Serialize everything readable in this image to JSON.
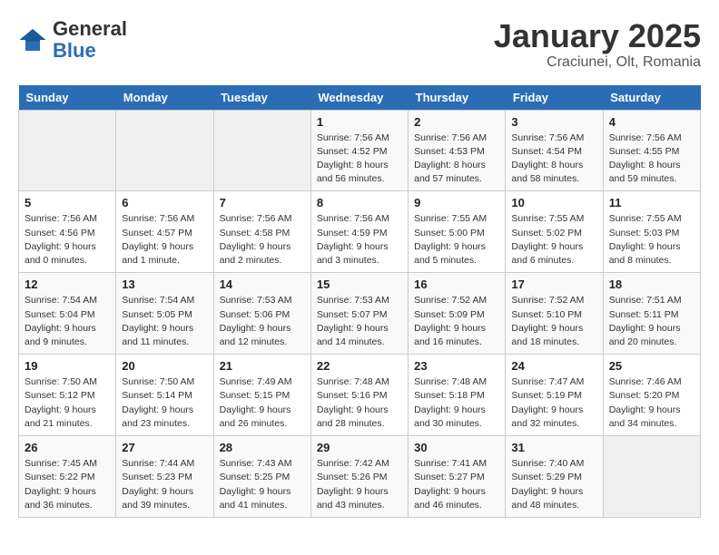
{
  "logo": {
    "general": "General",
    "blue": "Blue"
  },
  "header": {
    "title": "January 2025",
    "subtitle": "Craciunei, Olt, Romania"
  },
  "days_of_week": [
    "Sunday",
    "Monday",
    "Tuesday",
    "Wednesday",
    "Thursday",
    "Friday",
    "Saturday"
  ],
  "weeks": [
    [
      {
        "day": "",
        "info": ""
      },
      {
        "day": "",
        "info": ""
      },
      {
        "day": "",
        "info": ""
      },
      {
        "day": "1",
        "info": "Sunrise: 7:56 AM\nSunset: 4:52 PM\nDaylight: 8 hours\nand 56 minutes."
      },
      {
        "day": "2",
        "info": "Sunrise: 7:56 AM\nSunset: 4:53 PM\nDaylight: 8 hours\nand 57 minutes."
      },
      {
        "day": "3",
        "info": "Sunrise: 7:56 AM\nSunset: 4:54 PM\nDaylight: 8 hours\nand 58 minutes."
      },
      {
        "day": "4",
        "info": "Sunrise: 7:56 AM\nSunset: 4:55 PM\nDaylight: 8 hours\nand 59 minutes."
      }
    ],
    [
      {
        "day": "5",
        "info": "Sunrise: 7:56 AM\nSunset: 4:56 PM\nDaylight: 9 hours\nand 0 minutes."
      },
      {
        "day": "6",
        "info": "Sunrise: 7:56 AM\nSunset: 4:57 PM\nDaylight: 9 hours\nand 1 minute."
      },
      {
        "day": "7",
        "info": "Sunrise: 7:56 AM\nSunset: 4:58 PM\nDaylight: 9 hours\nand 2 minutes."
      },
      {
        "day": "8",
        "info": "Sunrise: 7:56 AM\nSunset: 4:59 PM\nDaylight: 9 hours\nand 3 minutes."
      },
      {
        "day": "9",
        "info": "Sunrise: 7:55 AM\nSunset: 5:00 PM\nDaylight: 9 hours\nand 5 minutes."
      },
      {
        "day": "10",
        "info": "Sunrise: 7:55 AM\nSunset: 5:02 PM\nDaylight: 9 hours\nand 6 minutes."
      },
      {
        "day": "11",
        "info": "Sunrise: 7:55 AM\nSunset: 5:03 PM\nDaylight: 9 hours\nand 8 minutes."
      }
    ],
    [
      {
        "day": "12",
        "info": "Sunrise: 7:54 AM\nSunset: 5:04 PM\nDaylight: 9 hours\nand 9 minutes."
      },
      {
        "day": "13",
        "info": "Sunrise: 7:54 AM\nSunset: 5:05 PM\nDaylight: 9 hours\nand 11 minutes."
      },
      {
        "day": "14",
        "info": "Sunrise: 7:53 AM\nSunset: 5:06 PM\nDaylight: 9 hours\nand 12 minutes."
      },
      {
        "day": "15",
        "info": "Sunrise: 7:53 AM\nSunset: 5:07 PM\nDaylight: 9 hours\nand 14 minutes."
      },
      {
        "day": "16",
        "info": "Sunrise: 7:52 AM\nSunset: 5:09 PM\nDaylight: 9 hours\nand 16 minutes."
      },
      {
        "day": "17",
        "info": "Sunrise: 7:52 AM\nSunset: 5:10 PM\nDaylight: 9 hours\nand 18 minutes."
      },
      {
        "day": "18",
        "info": "Sunrise: 7:51 AM\nSunset: 5:11 PM\nDaylight: 9 hours\nand 20 minutes."
      }
    ],
    [
      {
        "day": "19",
        "info": "Sunrise: 7:50 AM\nSunset: 5:12 PM\nDaylight: 9 hours\nand 21 minutes."
      },
      {
        "day": "20",
        "info": "Sunrise: 7:50 AM\nSunset: 5:14 PM\nDaylight: 9 hours\nand 23 minutes."
      },
      {
        "day": "21",
        "info": "Sunrise: 7:49 AM\nSunset: 5:15 PM\nDaylight: 9 hours\nand 26 minutes."
      },
      {
        "day": "22",
        "info": "Sunrise: 7:48 AM\nSunset: 5:16 PM\nDaylight: 9 hours\nand 28 minutes."
      },
      {
        "day": "23",
        "info": "Sunrise: 7:48 AM\nSunset: 5:18 PM\nDaylight: 9 hours\nand 30 minutes."
      },
      {
        "day": "24",
        "info": "Sunrise: 7:47 AM\nSunset: 5:19 PM\nDaylight: 9 hours\nand 32 minutes."
      },
      {
        "day": "25",
        "info": "Sunrise: 7:46 AM\nSunset: 5:20 PM\nDaylight: 9 hours\nand 34 minutes."
      }
    ],
    [
      {
        "day": "26",
        "info": "Sunrise: 7:45 AM\nSunset: 5:22 PM\nDaylight: 9 hours\nand 36 minutes."
      },
      {
        "day": "27",
        "info": "Sunrise: 7:44 AM\nSunset: 5:23 PM\nDaylight: 9 hours\nand 39 minutes."
      },
      {
        "day": "28",
        "info": "Sunrise: 7:43 AM\nSunset: 5:25 PM\nDaylight: 9 hours\nand 41 minutes."
      },
      {
        "day": "29",
        "info": "Sunrise: 7:42 AM\nSunset: 5:26 PM\nDaylight: 9 hours\nand 43 minutes."
      },
      {
        "day": "30",
        "info": "Sunrise: 7:41 AM\nSunset: 5:27 PM\nDaylight: 9 hours\nand 46 minutes."
      },
      {
        "day": "31",
        "info": "Sunrise: 7:40 AM\nSunset: 5:29 PM\nDaylight: 9 hours\nand 48 minutes."
      },
      {
        "day": "",
        "info": ""
      }
    ]
  ]
}
